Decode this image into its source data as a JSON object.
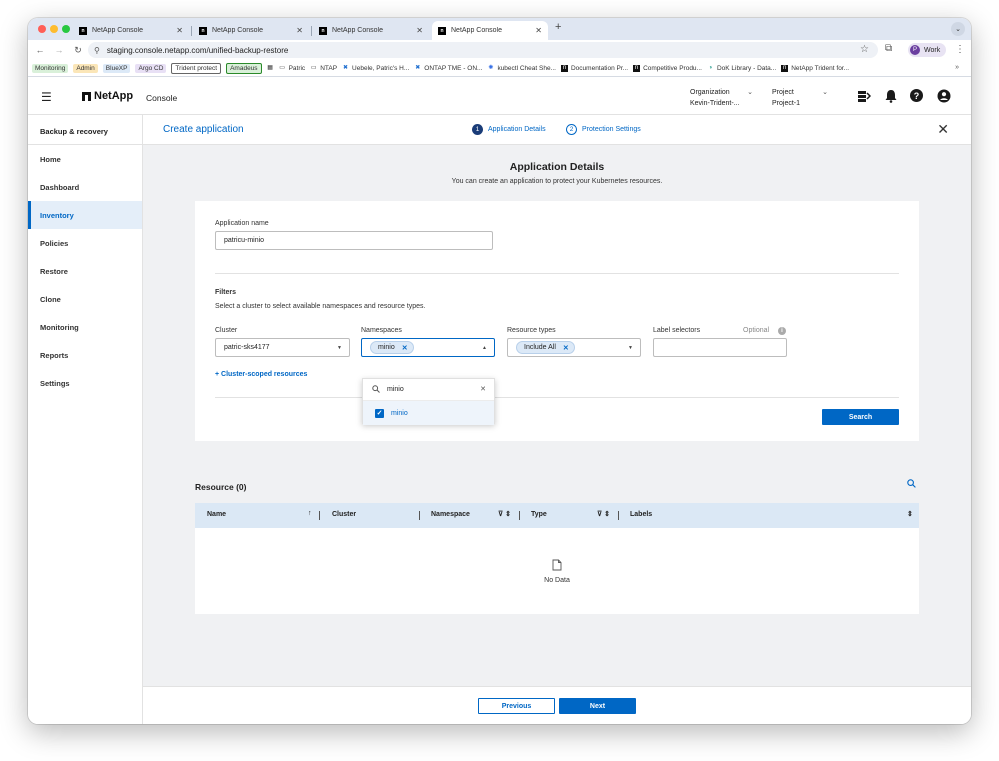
{
  "browser": {
    "tabs": [
      {
        "title": "NetApp Console"
      },
      {
        "title": "NetApp Console"
      },
      {
        "title": "NetApp Console"
      },
      {
        "title": "NetApp Console"
      }
    ],
    "url": "staging.console.netapp.com/unified-backup-restore",
    "profile_label": "Work",
    "profile_initial": "P",
    "bookmarks": [
      {
        "label": "Monitoring",
        "color": "#d9f0d9"
      },
      {
        "label": "Admin",
        "color": "#fbe6b8"
      },
      {
        "label": "BlueXP",
        "color": "#dce9f7"
      },
      {
        "label": "Argo CD",
        "color": "#e8e0f5"
      },
      {
        "label": "Trident protect",
        "color": "#ffffff"
      },
      {
        "label": "Amadeus",
        "color": "#d9f0d9"
      }
    ],
    "bookmark_links": [
      "Patric",
      "NTAP",
      "Uebele, Patric's H...",
      "ONTAP TME - ON...",
      "kubectl Cheat She...",
      "Documentation Pr...",
      "Competitive Produ...",
      "DoK Library - Data...",
      "NetApp Trident for..."
    ]
  },
  "header": {
    "brand": "NetApp",
    "product": "Console",
    "org_label": "Organization",
    "org_value": "Kevin-Trident-...",
    "project_label": "Project",
    "project_value": "Project-1"
  },
  "sidebar": {
    "title": "Backup & recovery",
    "items": [
      {
        "label": "Home"
      },
      {
        "label": "Dashboard"
      },
      {
        "label": "Inventory"
      },
      {
        "label": "Policies"
      },
      {
        "label": "Restore"
      },
      {
        "label": "Clone"
      },
      {
        "label": "Monitoring"
      },
      {
        "label": "Reports"
      },
      {
        "label": "Settings"
      }
    ],
    "active_item": "Inventory"
  },
  "wizard": {
    "title": "Create application",
    "steps": [
      {
        "num": "1",
        "label": "Application Details"
      },
      {
        "num": "2",
        "label": "Protection Settings"
      }
    ]
  },
  "details": {
    "title": "Application Details",
    "subtitle": "You can create an application to protect your Kubernetes resources.",
    "app_name_label": "Application name",
    "app_name_value": "patricu-minio",
    "filters_label": "Filters",
    "filters_help": "Select a cluster to select available namespaces and resource types.",
    "cluster_label": "Cluster",
    "cluster_value": "patric-sks4177",
    "namespaces_label": "Namespaces",
    "namespace_chip": "minio",
    "resource_types_label": "Resource types",
    "resource_types_chip": "Include All",
    "label_selectors_label": "Label selectors",
    "optional_label": "Optional",
    "cluster_scoped_link": "+ Cluster-scoped resources",
    "search_button": "Search",
    "dropdown_search_value": "minio",
    "dropdown_option": "minio"
  },
  "resources": {
    "title": "Resource (0)",
    "columns": [
      "Name",
      "Cluster",
      "Namespace",
      "Type",
      "Labels"
    ],
    "empty_text": "No Data"
  },
  "footer": {
    "previous": "Previous",
    "next": "Next"
  },
  "colors": {
    "primary": "#0067c5",
    "step_active": "#1a3c78",
    "table_header": "#dbe8f5"
  }
}
